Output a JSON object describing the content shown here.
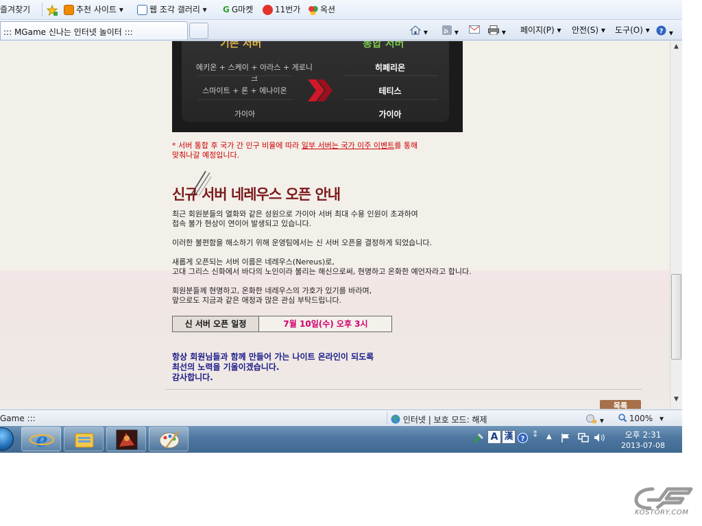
{
  "favorites_bar": {
    "favorites_label": "즐겨찾기",
    "items": [
      {
        "label": "추천 사이트 ▾"
      },
      {
        "label": "웹 조각 갤러리 ▾"
      },
      {
        "label": "G마켓"
      },
      {
        "label": "11번가"
      },
      {
        "label": "옥션"
      }
    ]
  },
  "tab": {
    "title": "::: MGame 신나는 인터넷 놀이터 :::"
  },
  "command_bar": {
    "page_menu": "페이지(P) ▾",
    "safety_menu": "안전(S) ▾",
    "tools_menu": "도구(O) ▾"
  },
  "banner": {
    "existing_server_heading": "기존 서버",
    "merged_server_heading": "통합 서버",
    "rows": [
      {
        "from": "에키온 + 스케이 + 아라스 + 게로니크",
        "to": "히페리온"
      },
      {
        "from": "스마이트 + 론 + 에나이온",
        "to": "테티스"
      },
      {
        "from": "가이아",
        "to": "가이아"
      }
    ]
  },
  "note": {
    "prefix": "* 서버 통합 후 국가 간 인구 비율에 따라 ",
    "underlined": "일부 서버는 국가 이주 이벤트",
    "suffix": "를 통해",
    "line2": "맞춰나갈 예정입니다."
  },
  "section": {
    "title": "신규 서버 네레우스 오픈 안내",
    "paragraphs": [
      [
        "최근 회원분들의 열화와 같은 성원으로 가이아 서버 최대 수용 인원이 초과하여",
        "접속 불가 현상이 연이어 발생되고 있습니다."
      ],
      [
        "이러한 불편함을 해소하기 위해 운영팀에서는 신 서버 오픈을 결정하게 되었습니다."
      ],
      [
        "새롭게 오픈되는 서버 이름은 네레우스(Nereus)로,",
        "고대 그리스 신화에서 바다의 노인이라 불리는 해신으로써, 현명하고 온화한 예언자라고 합니다."
      ],
      [
        "회원분들께 현명하고, 온화한 네레우스의 가호가 있기를 바라며,",
        "앞으로도 지금과 같은 애정과 많은 관심 부탁드립니다."
      ]
    ],
    "schedule_label": "신 서버 오픈 일정",
    "schedule_value": "7월 10일(수) 오후 3시",
    "closing": [
      "항상 회원님들과 함께 만들어 가는 나이트 온라인이 되도록",
      "최선의 노력을 기울이겠습니다.",
      "감사합니다."
    ],
    "list_button": "목록"
  },
  "status_bar": {
    "left_text": "Game :::",
    "zone_text": "인터넷 | 보호 모드: 해제",
    "zoom": "100%"
  },
  "taskbar": {
    "clock_time": "오후 2:31",
    "clock_date": "2013-07-08",
    "ime_a": "A",
    "ime_han": "漢"
  },
  "watermark": {
    "text": "KOSTORY.COM"
  },
  "colors": {
    "note_red": "#cc0000",
    "title_maroon": "#7a1919",
    "schedule_pink": "#d0006f",
    "closing_navy": "#1b1b8a"
  }
}
